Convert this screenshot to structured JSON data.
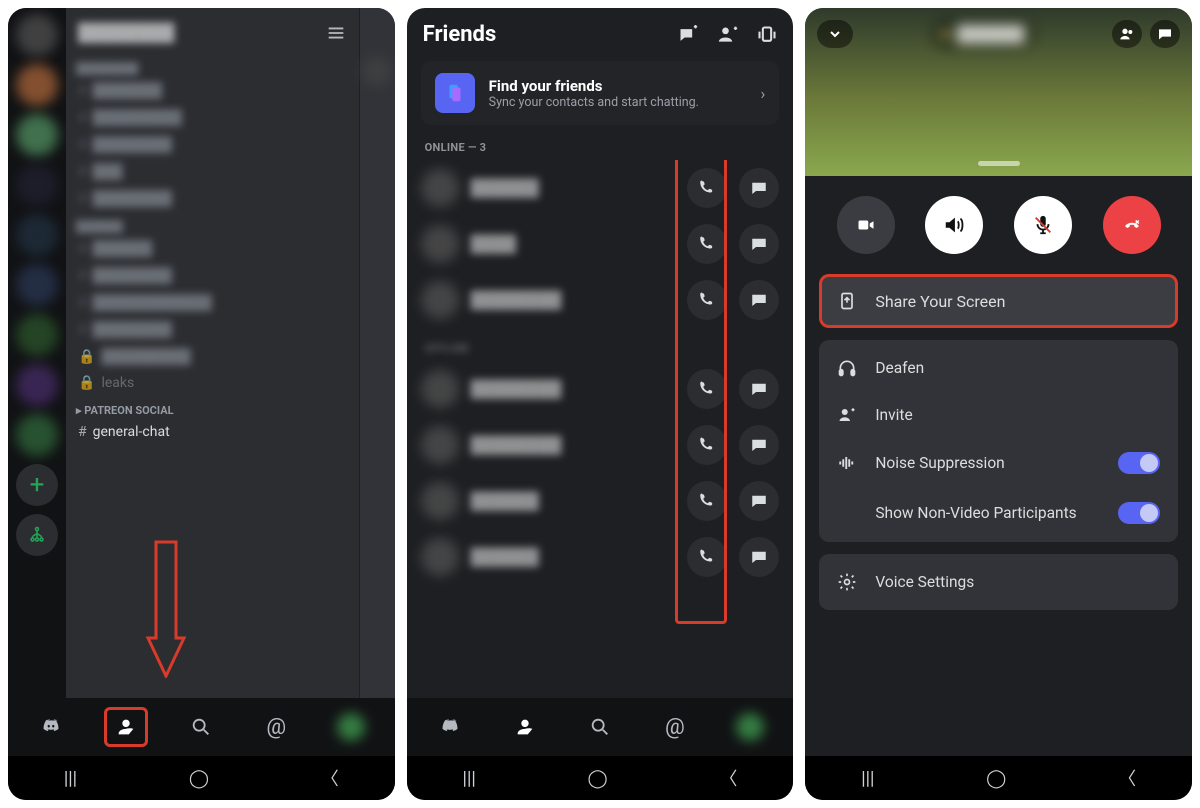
{
  "panel1": {
    "server_title": "████████",
    "channel_category_1": "████████",
    "channels_blur": [
      "███████",
      "█████████",
      "████████",
      "███",
      "████████",
      "██████",
      "████████",
      "████████████",
      "████████"
    ],
    "locked_label_1": "█████████",
    "locked_label_2": "leaks",
    "category_social": "PATREON SOCIAL",
    "general_chat": "general-chat"
  },
  "panel2": {
    "title": "Friends",
    "find_title": "Find your friends",
    "find_sub": "Sync your contacts and start chatting.",
    "online_header": "ONLINE — 3",
    "offline_header": "OFFLINE"
  },
  "panel3": {
    "call_name": "██████",
    "share_screen": "Share Your Screen",
    "deafen": "Deafen",
    "invite": "Invite",
    "noise": "Noise Suppression",
    "nonvideo": "Show Non-Video Participants",
    "voice_settings": "Voice Settings"
  }
}
